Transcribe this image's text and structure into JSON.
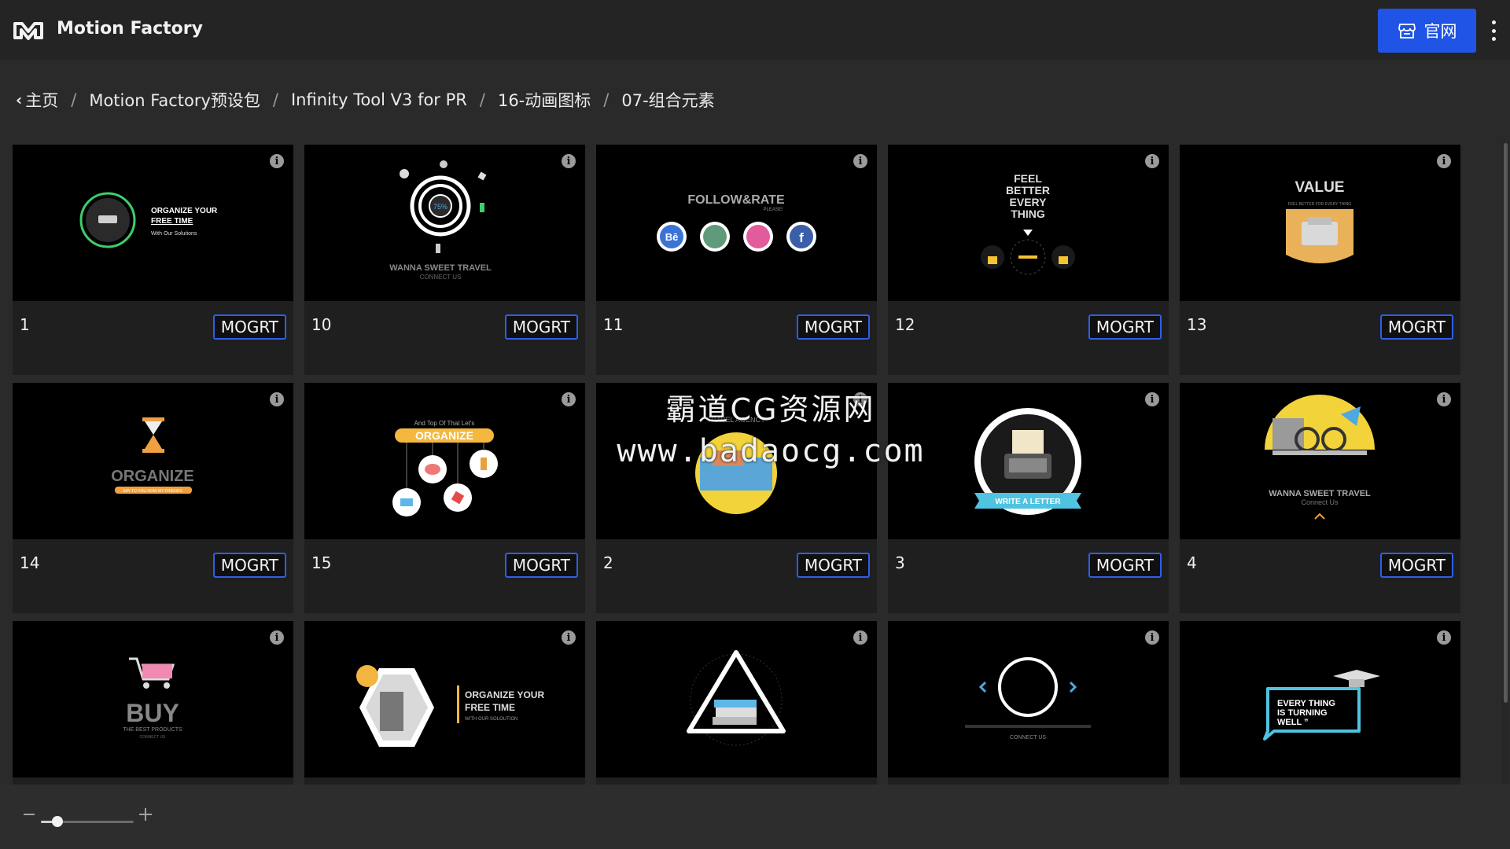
{
  "header": {
    "brand": "Motion Factory",
    "site_button_label": "官网",
    "logo_icon": "mf-logo-icon",
    "store_icon": "store-icon",
    "menu_icon": "kebab-menu-icon"
  },
  "breadcrumb": {
    "items": [
      "主页",
      "Motion Factory预设包",
      "Infinity Tool V3 for PR",
      "16-动画图标",
      "07-组合元素"
    ],
    "separator": "/"
  },
  "grid": {
    "button_label": "MOGRT",
    "items": [
      {
        "name": "1"
      },
      {
        "name": "10"
      },
      {
        "name": "11"
      },
      {
        "name": "12"
      },
      {
        "name": "13"
      },
      {
        "name": "14"
      },
      {
        "name": "15"
      },
      {
        "name": "2"
      },
      {
        "name": "3"
      },
      {
        "name": "4"
      },
      {
        "name": ""
      },
      {
        "name": ""
      },
      {
        "name": ""
      },
      {
        "name": ""
      },
      {
        "name": ""
      }
    ]
  },
  "thumb_text": {
    "t1_a": "ORGANIZE YOUR",
    "t1_b": "FREE TIME",
    "t1_c": "With Our Solutions",
    "t10_a": "WANNA SWEET TRAVEL",
    "t10_b": "CONNECT US",
    "t10_pct": "75%",
    "t11_a": "FOLLOW&RATE",
    "t11_b": "PLEASE!",
    "t11_be": "Bē",
    "t11_f": "f",
    "t12_a": "FEEL",
    "t12_b": "BETTER",
    "t12_c": "EVERY",
    "t12_d": "THING",
    "t13_a": "VALUE",
    "t13_b": "FEEL BETTER FOR EVERY THING",
    "t14_a": "ORGANIZE",
    "t14_b": "SAY TO YOU HOW MY FRIENDS",
    "t15_a": "And Top Of That Let's",
    "t15_b": "ORGANIZE",
    "t2_a": "TRAVEL AGENCY",
    "t3_a": "WRITE A LETTER",
    "t4_a": "WANNA SWEET TRAVEL",
    "t4_b": "Connect Us",
    "t16_a": "BUY",
    "t16_b": "THE BEST PRODUCTS",
    "t16_c": "CONNECT US",
    "t17_a": "ORGANIZE YOUR",
    "t17_b": "FREE TIME",
    "t17_c": "WITH OUR SOLOUTION",
    "t19_a": "CONNECT US",
    "t20_a": "EVERY THING",
    "t20_b": "IS TURNING",
    "t20_c": "WELL ”"
  },
  "watermark": {
    "line1": "霸道CG资源网",
    "line2": "www.badaocg.com"
  },
  "zoom": {
    "level": 0.18
  }
}
